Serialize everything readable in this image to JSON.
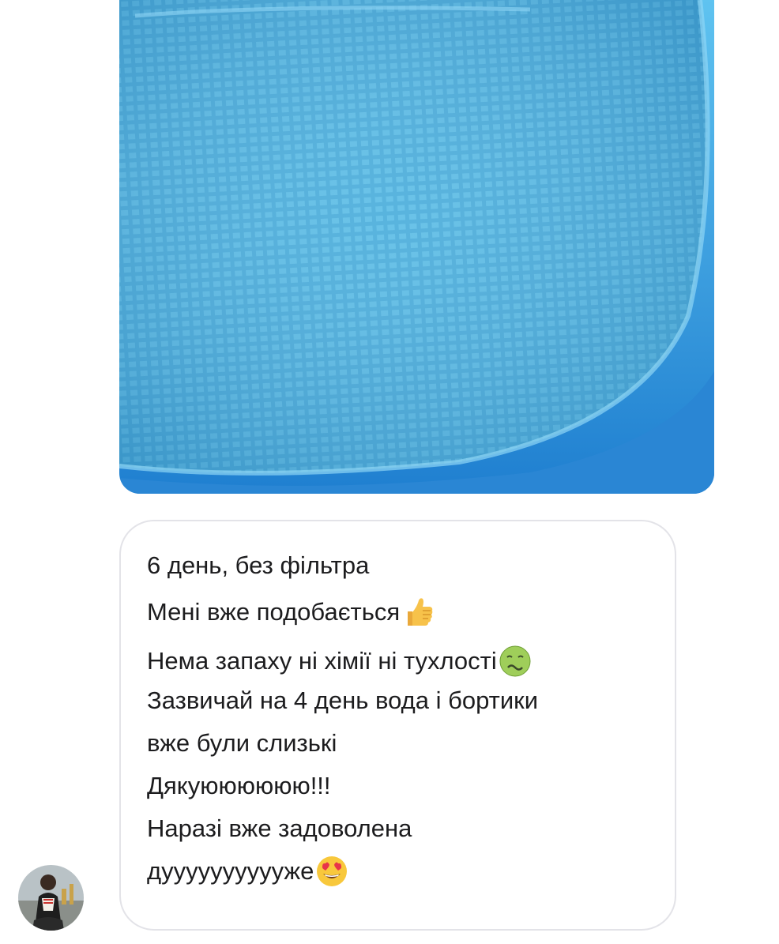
{
  "thread": {
    "photo": {
      "kind": "image",
      "subject": "pool-photo",
      "colors": {
        "water": "#4fb5e0",
        "tile_line": "#8fd3f0",
        "rim": "#2f8fd8"
      }
    },
    "message": {
      "lines": [
        {
          "text": "6 день, без фільтра",
          "emoji": ""
        },
        {
          "text": "Мені вже подобається",
          "emoji": "thumbs-up-icon"
        },
        {
          "text": "Нема запаху ні хімії ні тухлості",
          "emoji": "nauseated-face-icon"
        },
        {
          "text": "Зазвичай на 4 день вода і бортики",
          "emoji": ""
        },
        {
          "text": "вже були слизькі",
          "emoji": ""
        },
        {
          "text": "Дякуюююююю!!!",
          "emoji": ""
        },
        {
          "text": "Наразі вже задоволена",
          "emoji": ""
        },
        {
          "text": "дууууууууууже",
          "emoji": "heart-eyes-icon"
        }
      ]
    },
    "sender": {
      "avatar": "avatar"
    },
    "colors": {
      "text": "#1c1c1e",
      "bubble_border": "#e3e3e8",
      "background": "#ffffff"
    }
  }
}
